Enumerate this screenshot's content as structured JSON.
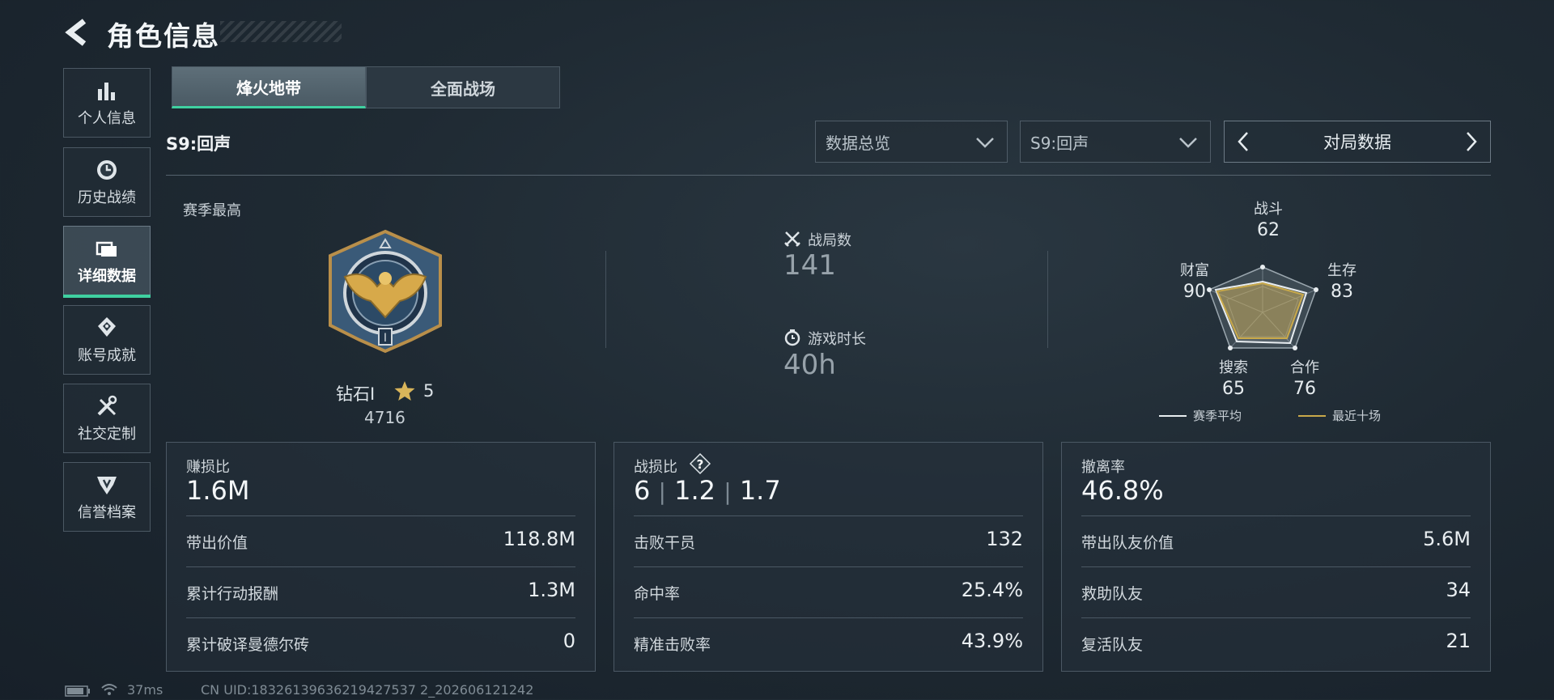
{
  "header": {
    "title": "角色信息"
  },
  "sidebar": {
    "items": [
      {
        "label": "个人信息",
        "icon": "bar-chart-icon"
      },
      {
        "label": "历史战绩",
        "icon": "clock-icon"
      },
      {
        "label": "详细数据",
        "icon": "folder-icon",
        "active": true
      },
      {
        "label": "账号成就",
        "icon": "achievement-icon"
      },
      {
        "label": "社交定制",
        "icon": "tools-icon"
      },
      {
        "label": "信誉档案",
        "icon": "emblem-icon"
      }
    ]
  },
  "tabs": [
    {
      "label": "烽火地带",
      "active": true
    },
    {
      "label": "全面战场",
      "active": false
    }
  ],
  "season_label": "S9:回声",
  "filters": {
    "view_select": "数据总览",
    "season_select": "S9:回声",
    "pager_label": "对局数据"
  },
  "rank": {
    "section_title": "赛季最高",
    "name": "钻石Ⅰ",
    "stars": "5",
    "score": "4716"
  },
  "match_stats": {
    "matches_label": "战局数",
    "matches_value": "141",
    "playtime_label": "游戏时长",
    "playtime_value": "40h"
  },
  "radar": {
    "axes": [
      {
        "label": "战斗",
        "value": 62
      },
      {
        "label": "生存",
        "value": 83
      },
      {
        "label": "合作",
        "value": 76
      },
      {
        "label": "搜索",
        "value": 65
      },
      {
        "label": "财富",
        "value": 90
      }
    ],
    "legend_season": "赛季平均",
    "legend_recent": "最近十场",
    "colors": {
      "season": "#e8edf0",
      "recent": "#c9a94a"
    }
  },
  "cards": [
    {
      "title": "赚损比",
      "main": "1.6M",
      "rows": [
        {
          "label": "带出价值",
          "value": "118.8M"
        },
        {
          "label": "累计行动报酬",
          "value": "1.3M"
        },
        {
          "label": "累计破译曼德尔砖",
          "value": "0"
        }
      ]
    },
    {
      "title": "战损比",
      "main_parts": [
        "6",
        "1.2",
        "1.7"
      ],
      "help": "?",
      "rows": [
        {
          "label": "击败干员",
          "value": "132"
        },
        {
          "label": "命中率",
          "value": "25.4%"
        },
        {
          "label": "精准击败率",
          "value": "43.9%"
        }
      ]
    },
    {
      "title": "撤离率",
      "main": "46.8%",
      "rows": [
        {
          "label": "带出队友价值",
          "value": "5.6M"
        },
        {
          "label": "救助队友",
          "value": "34"
        },
        {
          "label": "复活队友",
          "value": "21"
        }
      ]
    }
  ],
  "footer": {
    "ping": "37ms",
    "uid": "CN UID:18326139636219427537 2_202606121242"
  },
  "accent": "#3fd0a0"
}
